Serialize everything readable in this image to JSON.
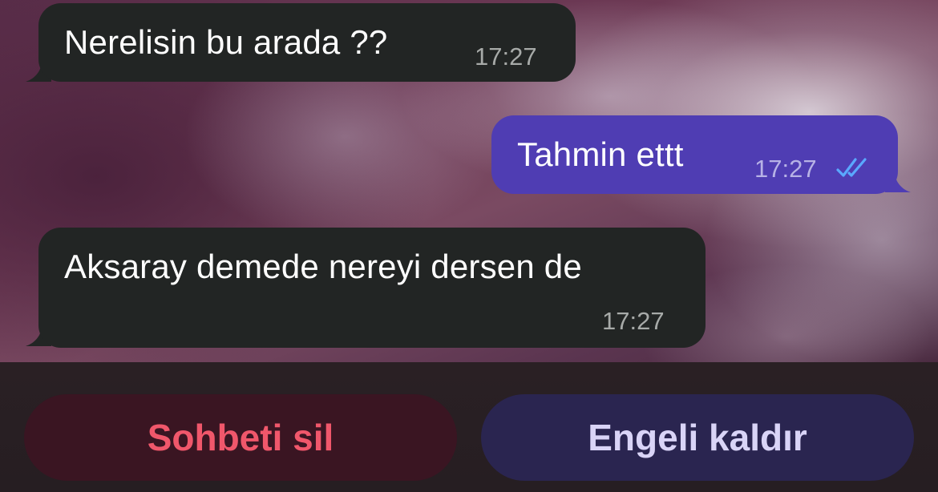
{
  "messages": [
    {
      "direction": "incoming",
      "text": "Nerelisin bu arada ??",
      "time": "17:27"
    },
    {
      "direction": "outgoing",
      "text": "Tahmin ettt",
      "time": "17:27",
      "status": "read"
    },
    {
      "direction": "incoming",
      "text": "Aksaray demede nereyi dersen de",
      "time": "17:27"
    }
  ],
  "actions": {
    "delete_chat_label": "Sohbeti sil",
    "unblock_label": "Engeli kaldır"
  },
  "colors": {
    "incoming_bubble": "#222524",
    "outgoing_bubble": "#4f3db3",
    "read_ticks": "#5aa8ff",
    "delete_text": "#f0576b",
    "unblock_text": "#d9d4f7"
  },
  "icons": {
    "read_receipt": "double-check-icon"
  }
}
